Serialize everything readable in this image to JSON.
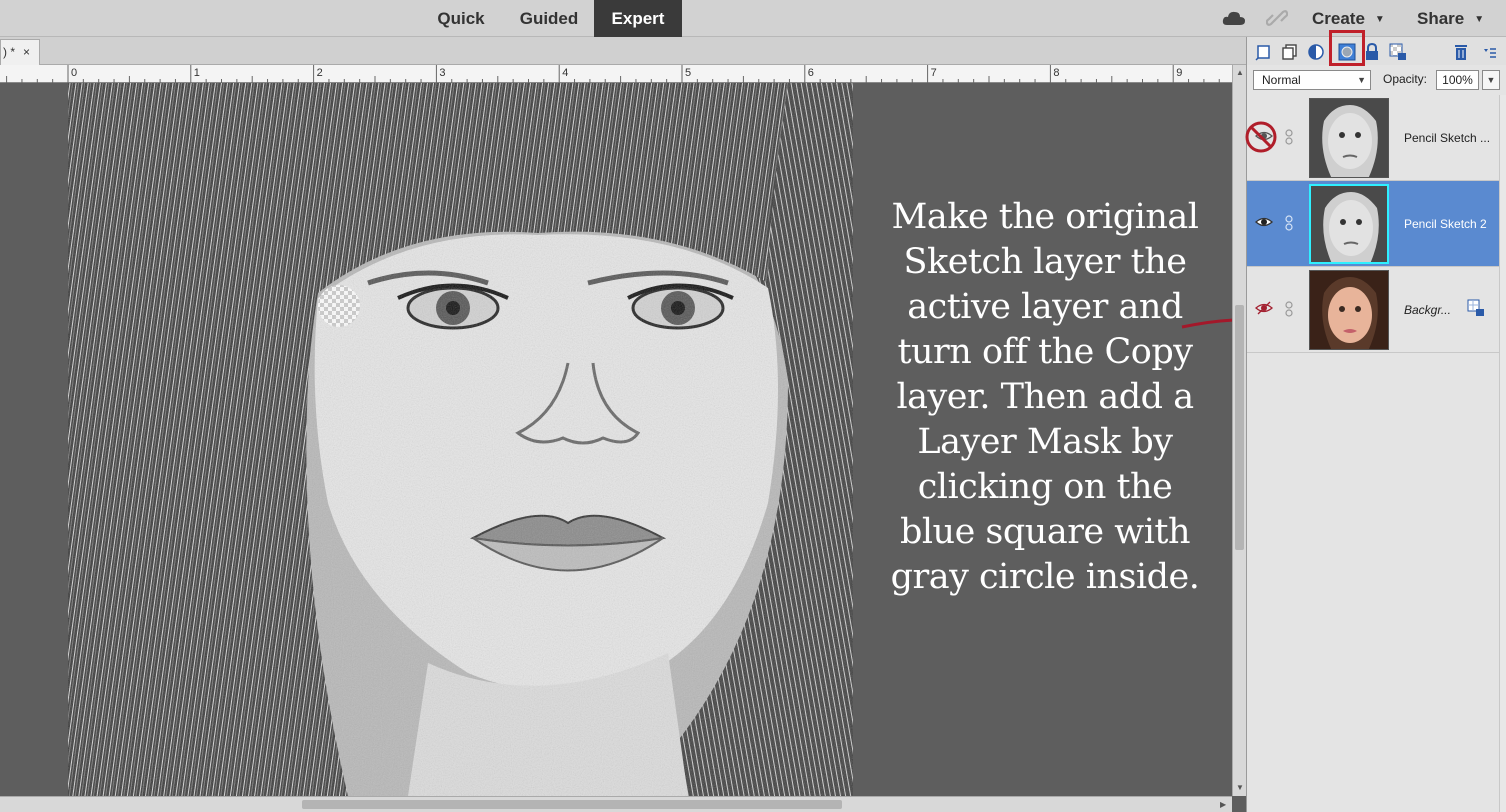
{
  "topbar": {
    "tabs": [
      "Quick",
      "Guided",
      "Expert"
    ],
    "active_tab": "Expert",
    "create_label": "Create",
    "share_label": "Share"
  },
  "document": {
    "tab_label": ") *",
    "close_glyph": "×"
  },
  "ruler": {
    "labels": [
      "0",
      "1",
      "2",
      "3",
      "4",
      "5",
      "6",
      "7",
      "8",
      "9"
    ]
  },
  "annotation": {
    "text": "Make the original\nSketch layer the\nactive layer and\nturn off the Copy\nlayer. Then add a\nLayer Mask by\nclicking on the\nblue square with\ngray circle inside.",
    "color": "#ffffff",
    "arrow_color": "#a3182a"
  },
  "layers_panel": {
    "blend_mode": "Normal",
    "opacity_label": "Opacity:",
    "opacity_value": "100%",
    "highlight_color": "#c0202a",
    "layers": [
      {
        "name": "Pencil Sketch ...",
        "visible": false,
        "active": false
      },
      {
        "name": "Pencil Sketch 2",
        "visible": true,
        "active": true
      },
      {
        "name": "Backgr...",
        "visible": false,
        "active": false
      }
    ]
  },
  "icons": {
    "toolbar": [
      "new-layer-icon",
      "new-group-icon",
      "adjustment-layer-icon",
      "add-layer-mask-icon",
      "lock-all-icon",
      "lock-transparency-icon",
      "delete-layer-icon",
      "panel-menu-icon"
    ]
  }
}
